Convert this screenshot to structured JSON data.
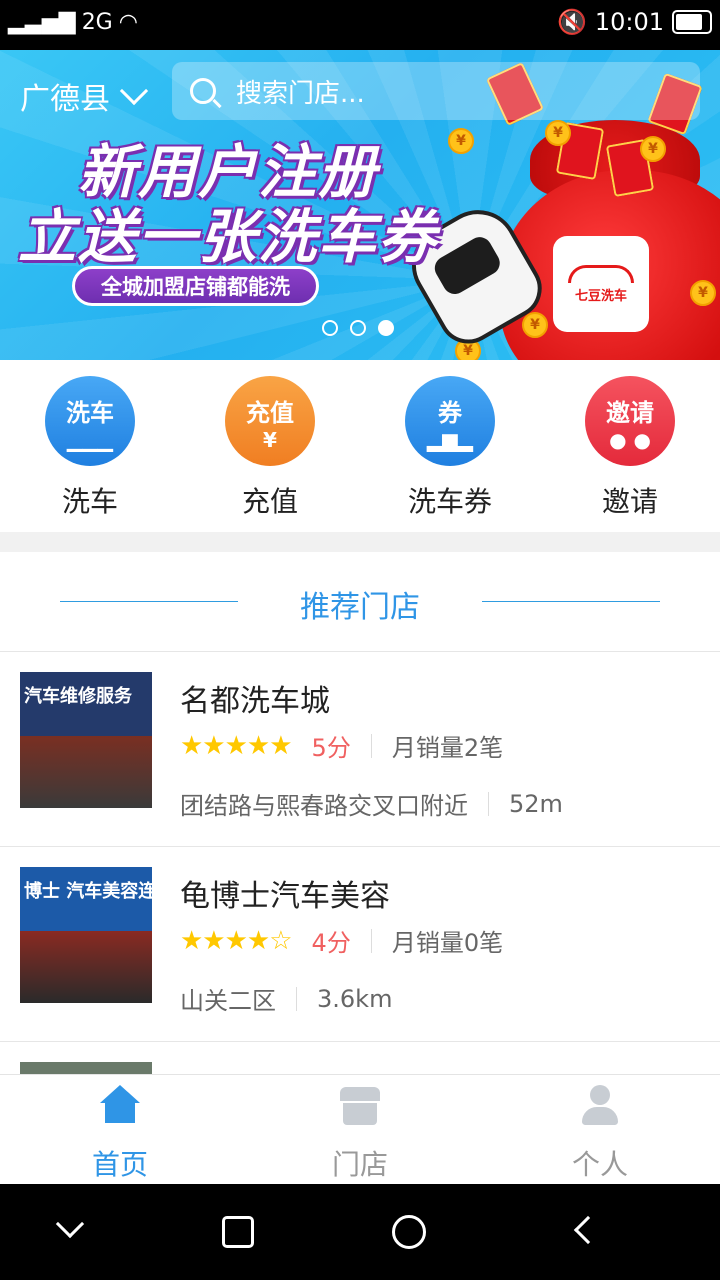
{
  "status_bar": {
    "network": "2G",
    "time": "10:01"
  },
  "header": {
    "city": "广德县",
    "search_placeholder": "搜索门店..."
  },
  "banner": {
    "line1": "新用户注册",
    "line2": "立送一张洗车券",
    "pill": "全城加盟店铺都能洗",
    "logo_text": "七豆洗车",
    "dots_count": 3,
    "active_dot": 3
  },
  "quick_actions": [
    {
      "icon_text": "洗车",
      "label": "洗车",
      "color": "#2f8fe8",
      "icon": "car-wash-icon"
    },
    {
      "icon_text": "充值",
      "sub": "¥",
      "label": "充值",
      "color": "#f7912f",
      "icon": "recharge-icon"
    },
    {
      "icon_text": "券",
      "label": "洗车券",
      "color": "#2f8fe8",
      "icon": "coupon-icon"
    },
    {
      "icon_text": "邀请",
      "label": "邀请",
      "color": "#ee3a4a",
      "icon": "invite-icon"
    }
  ],
  "recommended": {
    "title": "推荐门店",
    "stores": [
      {
        "name": "名都洗车城",
        "stars": "★★★★★",
        "rating": 5,
        "score": "5分",
        "sales": "月销量2笔",
        "address": "团结路与熙春路交叉口附近",
        "distance": "52m",
        "sign": "汽车维修服务"
      },
      {
        "name": "龟博士汽车美容",
        "stars": "★★★★☆",
        "rating": 4,
        "score": "4分",
        "sales": "月销量0笔",
        "address": "山关二区",
        "distance": "3.6km",
        "sign": "博士 汽车美容连"
      }
    ]
  },
  "tabbar": {
    "home": "首页",
    "stores": "门店",
    "profile": "个人",
    "active_color": "#2f95e6",
    "inactive_color": "#999999"
  }
}
